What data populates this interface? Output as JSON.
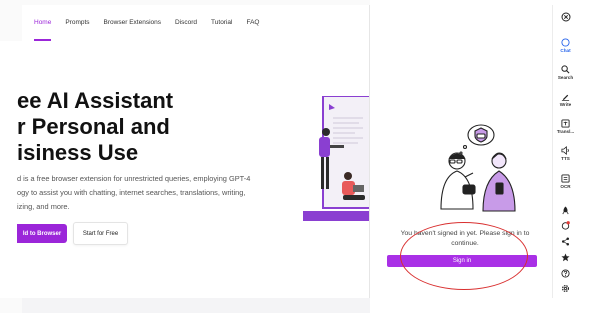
{
  "site": {
    "nav": [
      "Home",
      "Prompts",
      "Browser Extensions",
      "Discord",
      "Tutorial",
      "FAQ"
    ],
    "hero": {
      "title_lines": [
        "ee AI Assistant",
        "r Personal and",
        "isiness Use"
      ],
      "desc_lines": [
        "d is a free browser extension for unrestricted queries, employing GPT-4",
        "ogy to assist you with chatting, internet searches, translations, writing,",
        "izing, and more."
      ],
      "add_button": "ld to Browser",
      "free_button": "Start for Free"
    }
  },
  "panel": {
    "message": "You haven't signed in yet. Please sign in to continue.",
    "signin_button": "Sign in"
  },
  "sidebar": {
    "items": [
      {
        "label": "",
        "icon": "close-icon"
      },
      {
        "label": "Chat",
        "icon": "chat-icon",
        "active": true
      },
      {
        "label": "Search",
        "icon": "search-icon"
      },
      {
        "label": "Write",
        "icon": "write-icon"
      },
      {
        "label": "Transl...",
        "icon": "translate-icon"
      },
      {
        "label": "TTS",
        "icon": "speaker-icon"
      },
      {
        "label": "OCR",
        "icon": "ocr-icon"
      },
      {
        "label": "",
        "icon": "rocket-icon"
      },
      {
        "label": "",
        "icon": "notification-icon"
      },
      {
        "label": "",
        "icon": "share-icon"
      },
      {
        "label": "",
        "icon": "star-icon"
      },
      {
        "label": "",
        "icon": "help-icon"
      },
      {
        "label": "",
        "icon": "settings-icon"
      }
    ]
  },
  "colors": {
    "accent": "#9b26d9",
    "signin": "#a930e6",
    "active_blue": "#2563eb",
    "annotation": "#d93030"
  }
}
